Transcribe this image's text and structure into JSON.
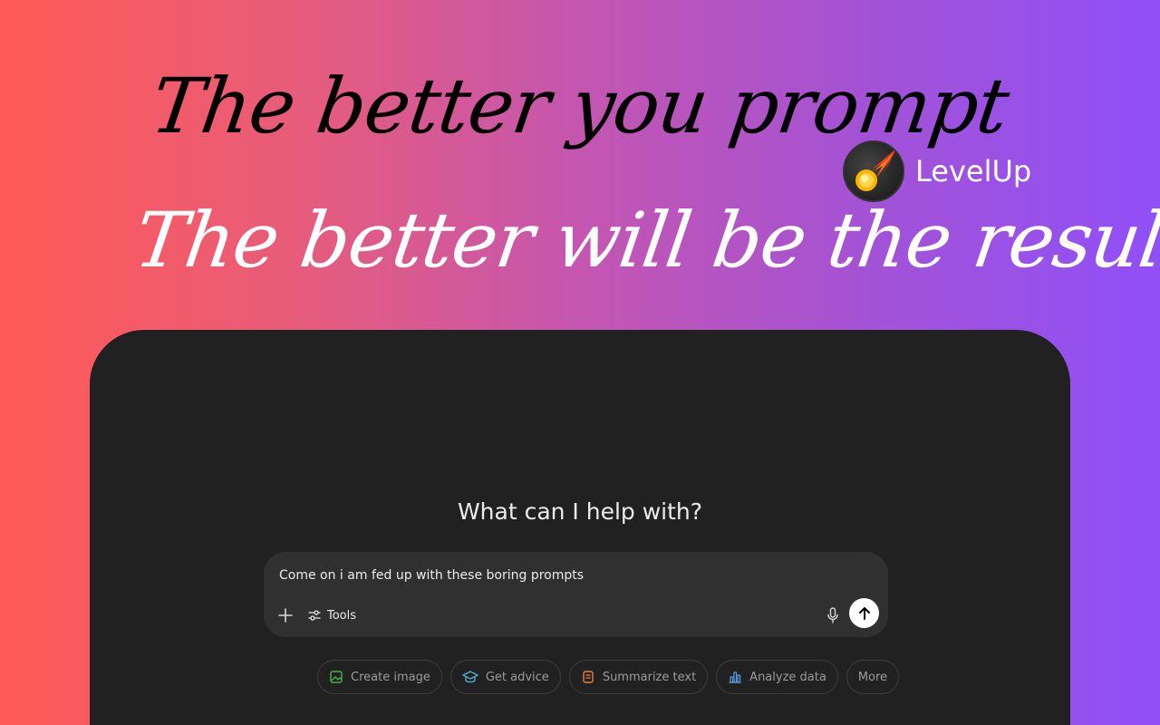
{
  "headline": {
    "line1": "The better you prompt",
    "line2": "The better will be the result"
  },
  "brand": {
    "name": "LevelUp",
    "logo_icon": "meteor-icon"
  },
  "chat": {
    "greeting": "What can I help with?",
    "input_value": "Come on i am fed up with these boring prompts",
    "tools_label": "Tools",
    "chips": [
      {
        "label": "Create image",
        "icon": "image-icon",
        "color": "#4caf50"
      },
      {
        "label": "Get advice",
        "icon": "graduation-cap-icon",
        "color": "#4fb3d9"
      },
      {
        "label": "Summarize text",
        "icon": "document-icon",
        "color": "#e8833a"
      },
      {
        "label": "Analyze data",
        "icon": "bar-chart-icon",
        "color": "#5a9be6"
      },
      {
        "label": "More",
        "icon": "",
        "color": ""
      }
    ]
  },
  "colors": {
    "gradient_start": "#ff5a55",
    "gradient_end": "#9050f7",
    "panel": "#212121",
    "composer": "#303030"
  }
}
